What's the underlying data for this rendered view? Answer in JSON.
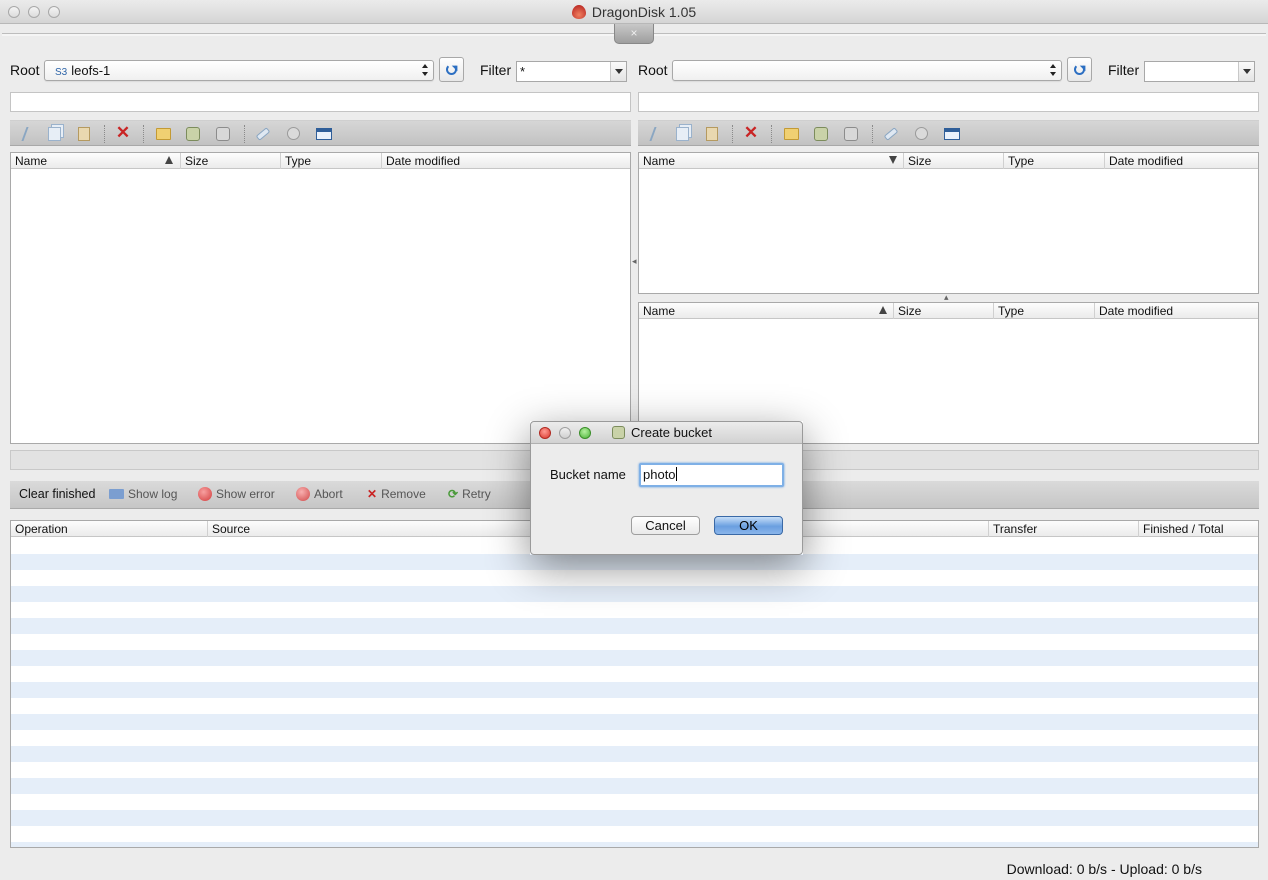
{
  "window": {
    "title": "DragonDisk 1.05"
  },
  "drawer_toggle_glyph": "×",
  "left_pane": {
    "root_label": "Root",
    "root_badge": "S3",
    "root_value": "leofs-1",
    "filter_label": "Filter",
    "filter_value": "*",
    "path_value": "",
    "columns": [
      "Name",
      "Size",
      "Type",
      "Date modified"
    ],
    "sort_column": "Name",
    "sort_direction": "ascending",
    "rows": []
  },
  "right_pane": {
    "root_label": "Root",
    "root_value": "",
    "filter_label": "Filter",
    "filter_value": "",
    "path_value": "",
    "top_columns": [
      "Name",
      "Size",
      "Type",
      "Date modified"
    ],
    "top_sort_direction": "descending",
    "bottom_columns": [
      "Name",
      "Size",
      "Type",
      "Date modified"
    ],
    "bottom_sort_direction": "ascending",
    "rows": []
  },
  "toolbar_icons": [
    "cut-icon",
    "copy-icon",
    "paste-icon",
    "delete-icon",
    "new-folder-icon",
    "create-bucket-icon",
    "bucket-properties-icon",
    "key-icon",
    "settings-icon",
    "window-icon"
  ],
  "queue": {
    "buttons": {
      "clear_finished": "Clear finished",
      "show_log": "Show log",
      "show_error": "Show error",
      "abort": "Abort",
      "remove": "Remove",
      "retry": "Retry"
    },
    "columns": [
      "Operation",
      "Source",
      "Transfer",
      "Finished / Total"
    ],
    "rows": []
  },
  "status": {
    "speed": "Download: 0 b/s - Upload: 0 b/s"
  },
  "dialog": {
    "title": "Create bucket",
    "field_label": "Bucket name",
    "field_value": "photo",
    "cancel_label": "Cancel",
    "ok_label": "OK"
  },
  "colors": {
    "accent_blue": "#2c6fc2",
    "default_button": "#6a9fe0",
    "delete_red": "#c92424",
    "row_stripe": "#e5eef9"
  }
}
